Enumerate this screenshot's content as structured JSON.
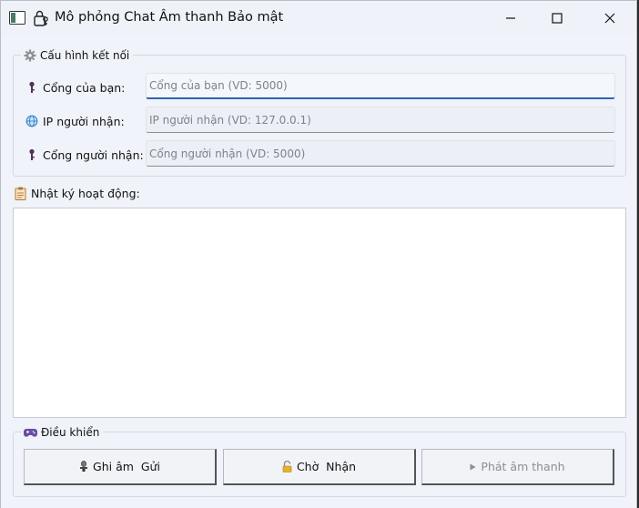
{
  "window": {
    "title": "Mô phỏng Chat Âm thanh Bảo mật"
  },
  "config": {
    "legend": "Cấu hình kết nối",
    "legend_icon": "gear-icon",
    "fields": [
      {
        "label": "Cổng của bạn:",
        "icon": "key-icon",
        "value": "",
        "placeholder": "Cổng của bạn (VD: 5000)"
      },
      {
        "label": "IP người nhận:",
        "icon": "globe-icon",
        "value": "",
        "placeholder": "IP người nhận (VD: 127.0.0.1)"
      },
      {
        "label": "Cổng người nhận:",
        "icon": "key-icon",
        "value": "",
        "placeholder": "Cổng người nhận (VD: 5000)"
      }
    ]
  },
  "log": {
    "label": "Nhật ký hoạt động:",
    "icon": "clipboard-icon",
    "content": ""
  },
  "controls": {
    "legend": "Điều khiển",
    "legend_icon": "gamepad-icon",
    "buttons": [
      {
        "label": "Ghi âm  Gửi",
        "icon": "microphone-icon",
        "enabled": true
      },
      {
        "label": "Chờ  Nhận",
        "icon": "lock-open-icon",
        "enabled": true
      },
      {
        "label": "Phát âm thanh",
        "icon": "play-icon",
        "enabled": false
      }
    ]
  },
  "colors": {
    "window_bg": "#f0f3f9",
    "focus_accent": "#2d64b3",
    "log_bg": "#ffffff"
  }
}
